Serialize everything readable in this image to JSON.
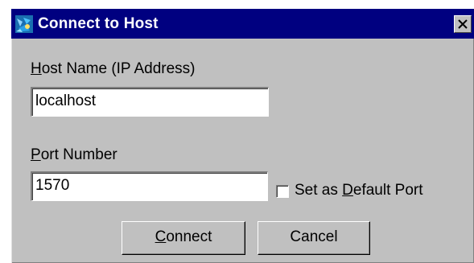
{
  "window": {
    "title": "Connect to Host",
    "app_icon": "java-app-icon",
    "close_glyph": "close-icon"
  },
  "host": {
    "label_mnemonic": "H",
    "label_rest": "ost Name (IP Address)",
    "value": "localhost"
  },
  "port": {
    "label_mnemonic": "P",
    "label_rest": "ort Number",
    "value": "1570"
  },
  "default_port": {
    "label_prefix": "Set as ",
    "label_mnemonic": "D",
    "label_rest": "efault Port",
    "checked": false
  },
  "buttons": {
    "connect_mnemonic": "C",
    "connect_rest": "onnect",
    "cancel": "Cancel"
  },
  "colors": {
    "titlebar": "#000080",
    "dialog_face": "#c0c0c0",
    "field_bg": "#ffffff"
  }
}
